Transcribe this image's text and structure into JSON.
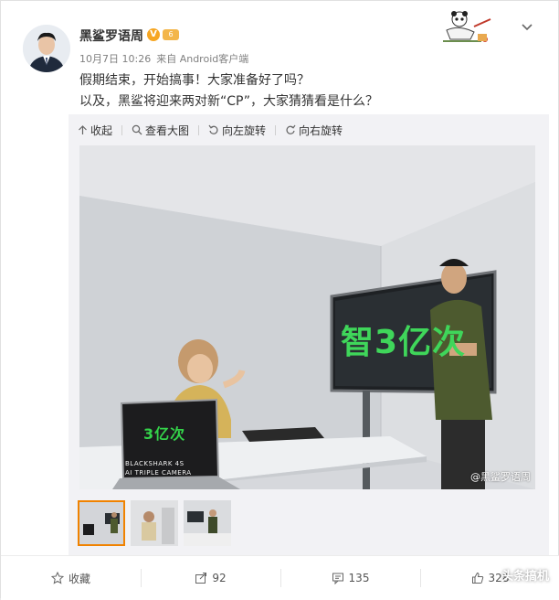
{
  "post": {
    "author": "黑鲨罗语周",
    "verified_badge": "V",
    "level_badge": "6",
    "date": "10月7日 10:26",
    "source": "来自 Android客户端",
    "lines": [
      "假期结束，开始搞事！大家准备好了吗？",
      "以及，黑鲨将迎来两对新“CP”，大家猜猜看是什么？"
    ]
  },
  "gallery_toolbar": {
    "collapse": "收起",
    "view_large": "查看大图",
    "rotate_left": "向左旋转",
    "rotate_right": "向右旋转"
  },
  "photo": {
    "laptop_screen_text": "3亿次",
    "laptop_brand": "BLACKSHARK 4S",
    "laptop_sub": "AI TRIPLE CAMERA",
    "tv_text": "智3亿次",
    "watermark": "@黑鲨罗语周"
  },
  "actions": {
    "favorite": "收藏",
    "repost_count": "92",
    "comment_count": "135",
    "like_count": "328"
  },
  "corner_watermark": "头条搞机",
  "icons": {
    "collapse": "arrow-up-icon",
    "view_large": "magnifier-icon",
    "rotate_left": "rotate-left-icon",
    "rotate_right": "rotate-right-icon",
    "favorite": "star-icon",
    "repost": "share-icon",
    "comment": "comment-icon",
    "like": "thumb-up-icon",
    "menu": "chevron-down-icon"
  },
  "colors": {
    "accent_green": "#3fd65a",
    "thumb_active_border": "#f08200",
    "badge_orange": "#f6a623"
  }
}
